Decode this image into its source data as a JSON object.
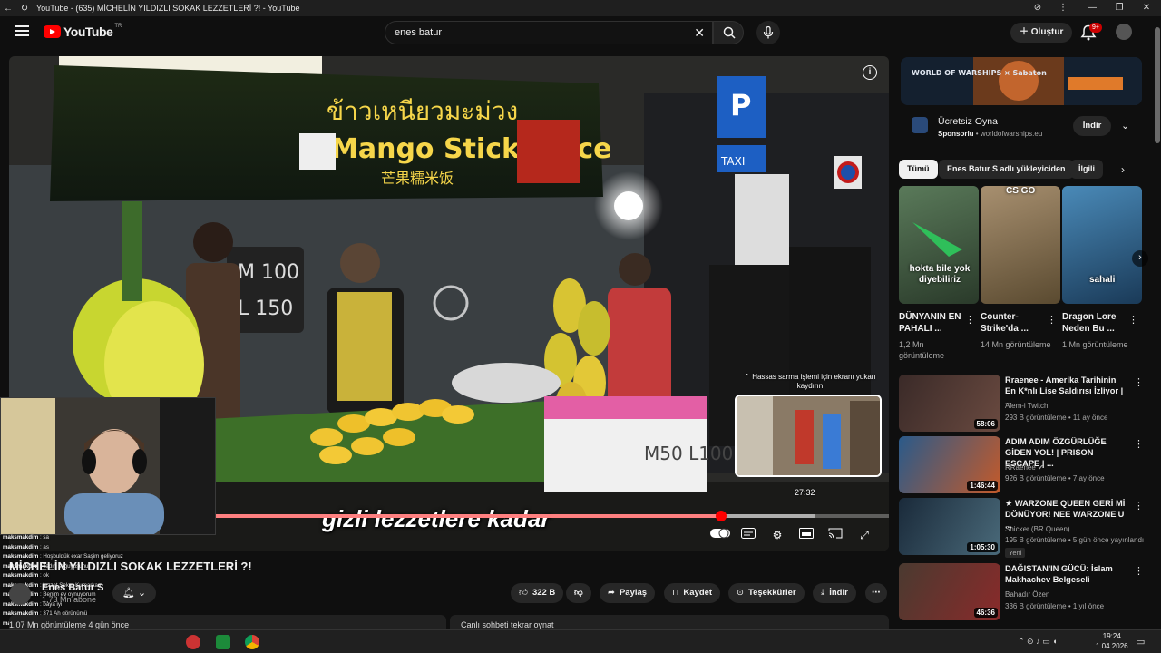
{
  "browser": {
    "tab_title": "YouTube - (635) MİCHELİN YILDIZLI SOKAK LEZZETLERİ ?! - YouTube"
  },
  "header": {
    "logo": "YouTube",
    "region": "TR",
    "search_value": "enes batur",
    "create_label": "Oluştur",
    "notification_count": "9+"
  },
  "player": {
    "subtitle": "gizli lezzetlere kadar",
    "hover_time": "27:32",
    "preview_note": "⌃ Hassas sarma işlemi için ekranı yukarı kaydırın",
    "progress": 0.75,
    "hover_position": 0.89,
    "sign_top": "ข้าวเหนียวมะม่วง",
    "sign_main": "Mango Sticky Rice",
    "sign_cn": "芒果糯米饭",
    "price_board": [
      "M 100",
      "L 150"
    ]
  },
  "video": {
    "title": "MİCHELİN YILDIZLI SOKAK LEZZETLERİ ?!",
    "channel": "Enes Batur S",
    "subs": "1,73 Mn abone",
    "views": "1,07 Mn görüntüleme  4 gün önce",
    "actions": {
      "like_count": "322 B",
      "share": "Paylaş",
      "save": "Kaydet",
      "thanks": "Teşekkürler",
      "download": "İndir"
    },
    "chat_replay": "Canlı sohbeti tekrar oynat"
  },
  "chat": [
    {
      "user": "maksmakdim",
      "msg": "sa"
    },
    {
      "user": "maksmakdim",
      "msg": "as"
    },
    {
      "user": "maksmakdim",
      "msg": "Hoşbuldük exar Saşim geliyoruz"
    },
    {
      "user": "maksmakdim",
      "msg": "Tadın soğuyuşunu"
    },
    {
      "user": "maksmakdim",
      "msg": "ok"
    },
    {
      "user": "maksmakdim",
      "msg": "lezzet Şeker Kumarkan"
    },
    {
      "user": "maksmakdim",
      "msg": "Benim ev oynuyorum"
    },
    {
      "user": "maksmakdim",
      "msg": "baya iyi"
    },
    {
      "user": "maksmakdim",
      "msg": "371 Ah görünümü"
    },
    {
      "user": "maksmakdim",
      "msg": "Kusura bakmayın telefondan çıkamayı ben"
    },
    {
      "user": "maksmakdim",
      "msg": "Seni bir sürü kişi izliyor niye yazmıyorlar"
    }
  ],
  "ad": {
    "title": "Ücretsiz Oyna",
    "sponsor": "Sponsorlu",
    "domain": "worldofwarships.eu",
    "button": "İndir",
    "banner_text": "WORLD OF WARSHIPS × Sabaton"
  },
  "chips": [
    "Tümü",
    "Enes Batur S adlı yükleyiciden",
    "İlgili"
  ],
  "shorts": [
    {
      "overlay": "hokta bile yok diyebiliriz",
      "title": "DÜNYANIN EN PAHALI ...",
      "views": "1,2 Mn görüntüleme"
    },
    {
      "overlay": "CS GO",
      "title": "Counter-Strike'da ...",
      "views": "14 Mn görüntüleme"
    },
    {
      "overlay": "sahali",
      "title": "Dragon Lore Neden Bu ...",
      "views": "1 Mn görüntüleme"
    }
  ],
  "recommended": [
    {
      "title": "Rraenee - Amerika Tarihinin En K*nlı Lise Saldırısı İzliyor | ...",
      "channel": "Alem-i Twitch",
      "meta": "293 B görüntüleme • 11 ay önce",
      "duration": "58:06"
    },
    {
      "title": "ADIM ADIM ÖZGÜRLÜĞE GİDEN YOL! | PRISON ESCAPE | ...",
      "channel": "RRaenee",
      "meta": "926 B görüntüleme • 7 ay önce",
      "duration": "1:46:44"
    },
    {
      "title": "★ WARZONE QUEEN GERİ Mİ DÖNÜYOR! NEE WARZONE'U ...",
      "channel": "Snicker (BR Queen)",
      "meta": "195 B görüntüleme • 5 gün önce yayınlandı",
      "duration": "1:05:30",
      "badge": "Yeni"
    },
    {
      "title": "DAĞISTAN'IN GÜCÜ: İslam Makhachev Belgeseli",
      "channel": "Bahadır Özen",
      "meta": "336 B görüntüleme • 1 yıl önce",
      "duration": "46:36"
    }
  ],
  "taskbar": {
    "time": "19:24",
    "date": "1.04.2026"
  },
  "colors": {
    "accent": "#ff0000",
    "background": "#0f0f0f",
    "chip_bg": "#272727"
  }
}
